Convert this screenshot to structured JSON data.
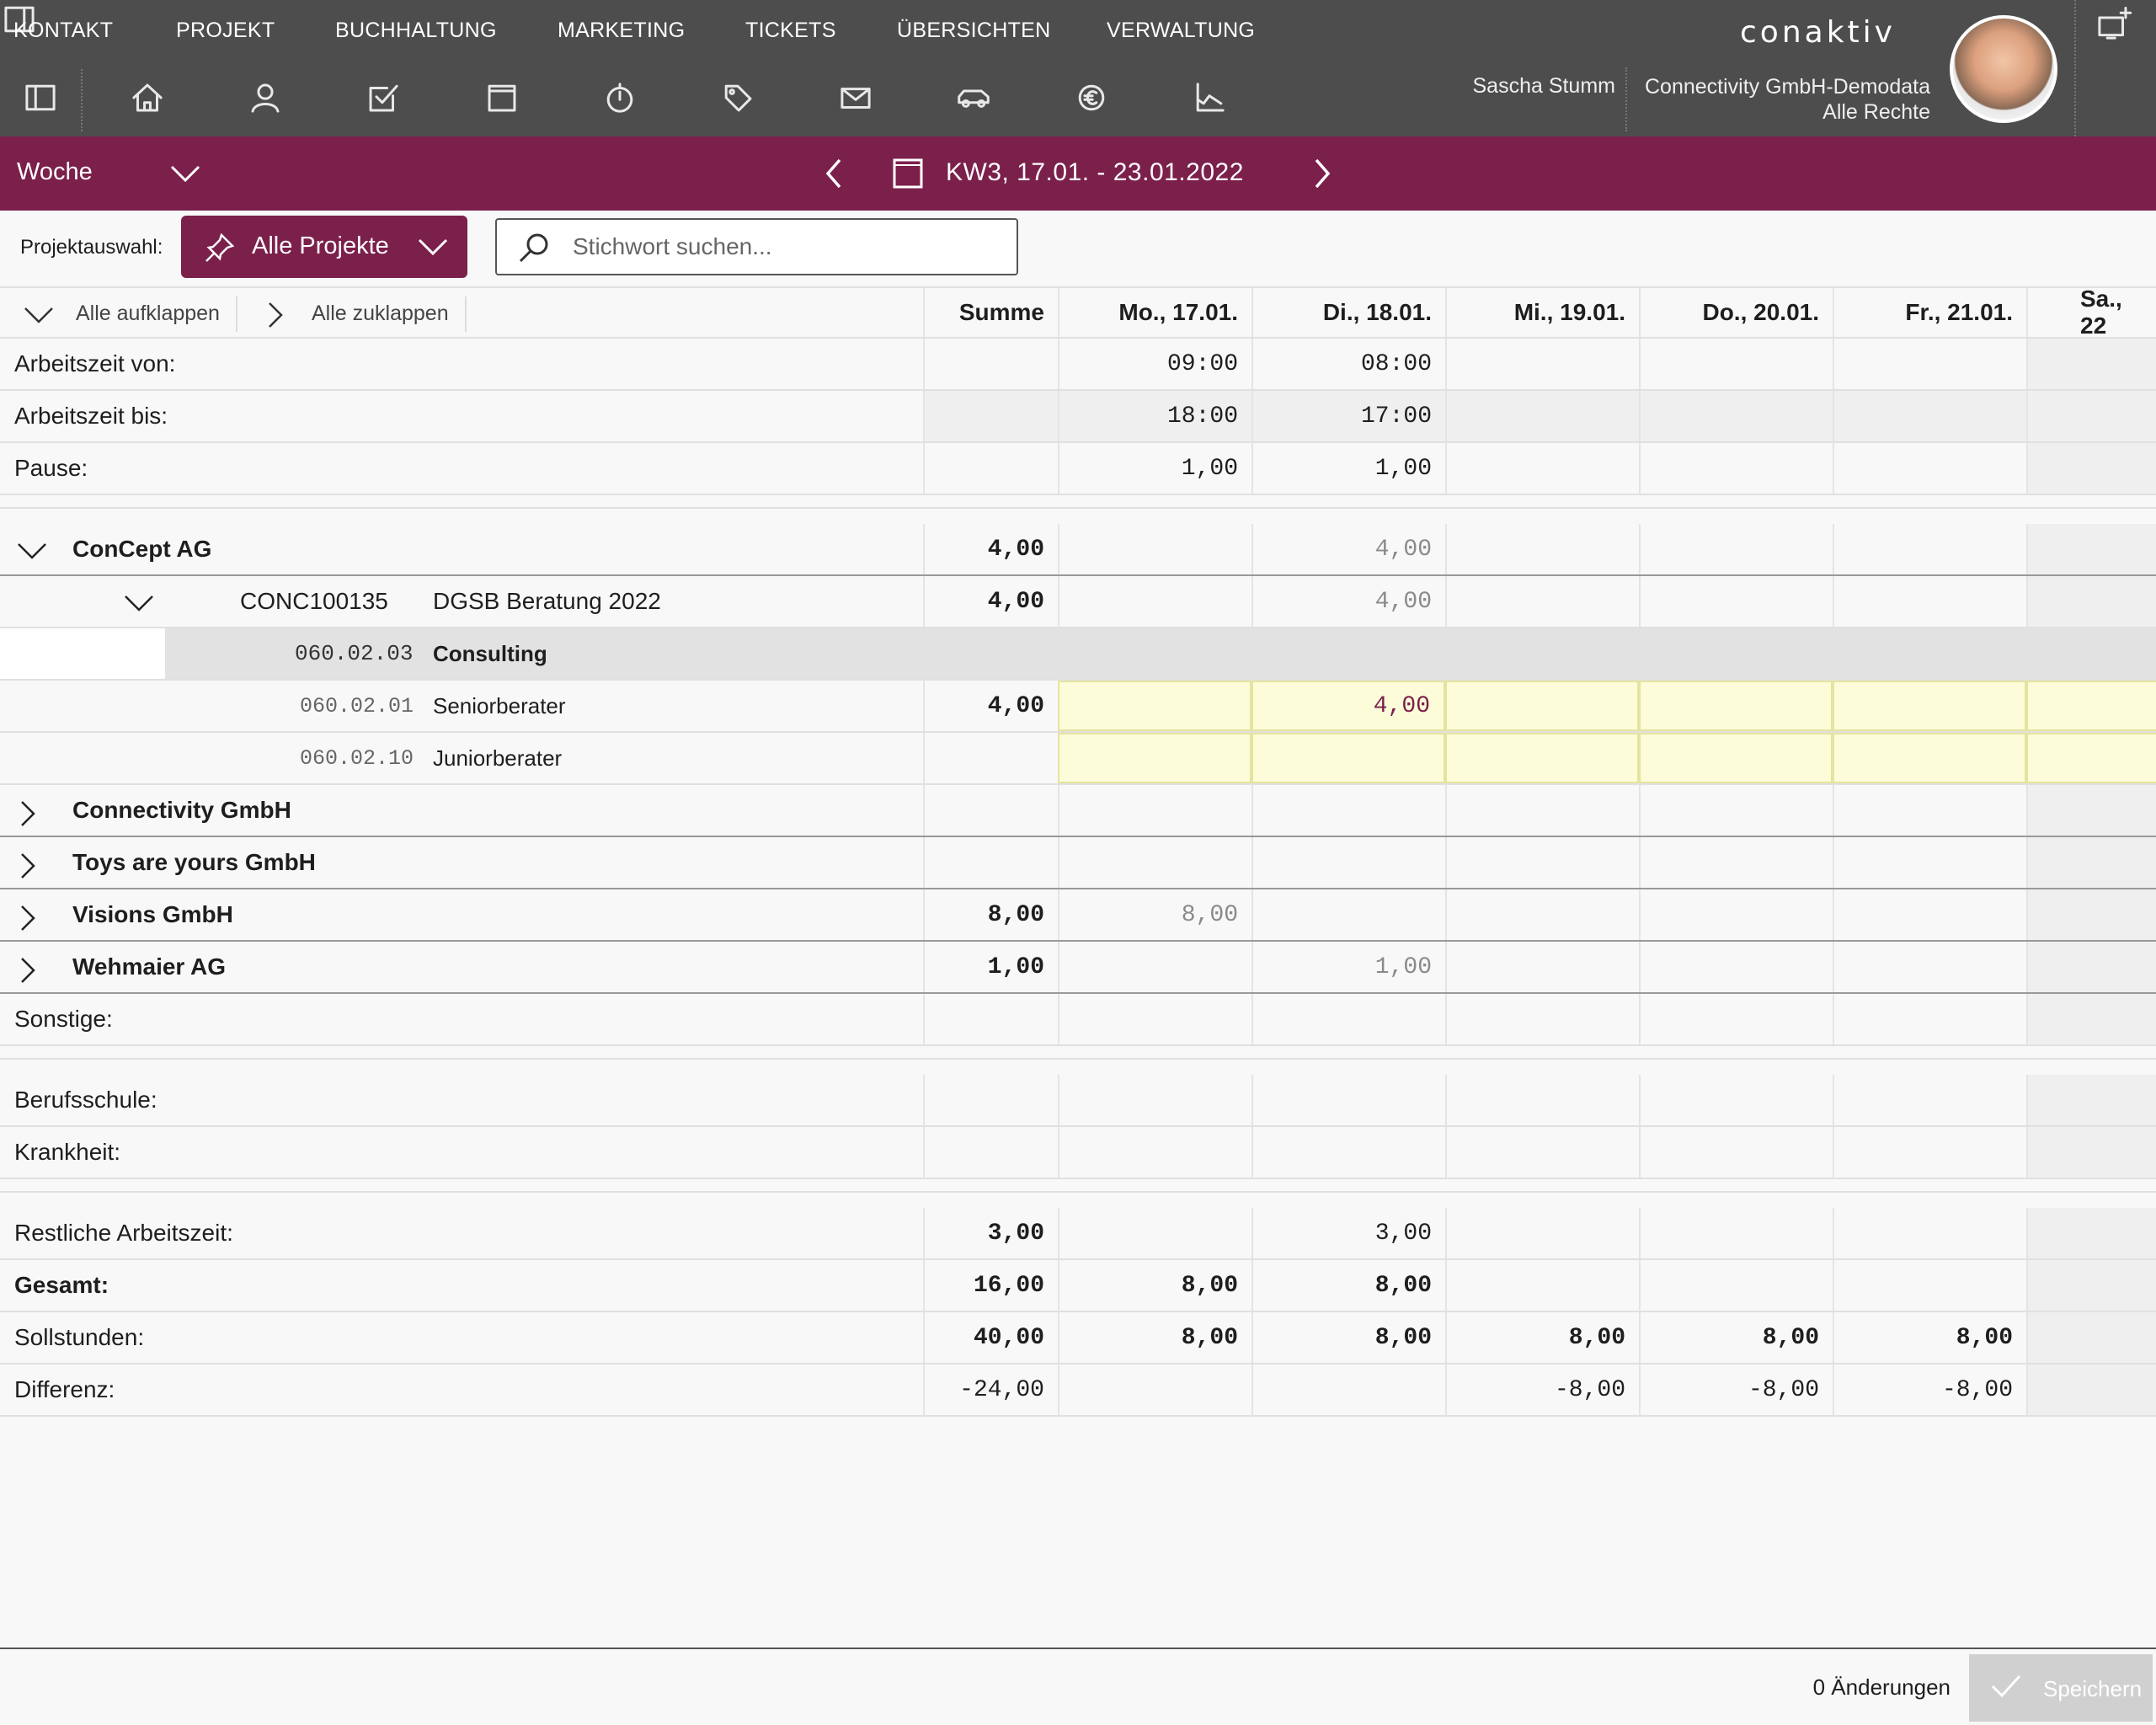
{
  "menu": [
    "KONTAKT",
    "PROJEKT",
    "BUCHHALTUNG",
    "MARKETING",
    "TICKETS",
    "ÜBERSICHTEN",
    "VERWALTUNG"
  ],
  "brand": "conaktiv",
  "user": {
    "name": "Sascha Stumm",
    "company": "Connectivity GmbH-Demodata",
    "rights": "Alle Rechte"
  },
  "period": {
    "view": "Woche",
    "label": "KW3, 17.01. - 23.01.2022"
  },
  "filter": {
    "label": "Projektauswahl:",
    "project": "Alle Projekte",
    "search_placeholder": "Stichwort suchen..."
  },
  "toolbar": {
    "expand": "Alle aufklappen",
    "collapse": "Alle zuklappen"
  },
  "columns": [
    "Summe",
    "Mo., 17.01.",
    "Di., 18.01.",
    "Mi., 19.01.",
    "Do., 20.01.",
    "Fr., 21.01.",
    "Sa., 22"
  ],
  "rows": {
    "von": {
      "label": "Arbeitszeit von:",
      "mo": "09:00",
      "di": "08:00"
    },
    "bis": {
      "label": "Arbeitszeit bis:",
      "mo": "18:00",
      "di": "17:00"
    },
    "pause": {
      "label": "Pause:",
      "mo": "1,00",
      "di": "1,00"
    },
    "concept": {
      "label": "ConCept AG",
      "sum": "4,00",
      "di": "4,00"
    },
    "project": {
      "code": "CONC100135",
      "name": "DGSB Beratung 2022",
      "sum": "4,00",
      "di": "4,00"
    },
    "consulting": {
      "code": "060.02.03",
      "name": "Consulting"
    },
    "senior": {
      "code": "060.02.01",
      "name": "Seniorberater",
      "sum": "4,00",
      "di": "4,00"
    },
    "junior": {
      "code": "060.02.10",
      "name": "Juniorberater"
    },
    "connectivity": {
      "label": "Connectivity GmbH"
    },
    "toys": {
      "label": "Toys are yours GmbH"
    },
    "visions": {
      "label": "Visions GmbH",
      "sum": "8,00",
      "mo": "8,00"
    },
    "wehmaier": {
      "label": "Wehmaier AG",
      "sum": "1,00",
      "di": "1,00"
    },
    "sonstige": {
      "label": "Sonstige:"
    },
    "berufsschule": {
      "label": "Berufsschule:"
    },
    "krankheit": {
      "label": "Krankheit:"
    },
    "rest": {
      "label": "Restliche Arbeitszeit:",
      "sum": "3,00",
      "di": "3,00"
    },
    "gesamt": {
      "label": "Gesamt:",
      "sum": "16,00",
      "mo": "8,00",
      "di": "8,00"
    },
    "soll": {
      "label": "Sollstunden:",
      "sum": "40,00",
      "mo": "8,00",
      "di": "8,00",
      "mi": "8,00",
      "do": "8,00",
      "fr": "8,00"
    },
    "diff": {
      "label": "Differenz:",
      "sum": "-24,00",
      "mi": "-8,00",
      "do": "-8,00",
      "fr": "-8,00"
    }
  },
  "footer": {
    "changes": "0 Änderungen",
    "save": "Speichern"
  },
  "colors": {
    "topbar": "#4d4d4d",
    "accent": "#7b1f4b",
    "highlight": "#fcfcd8"
  }
}
